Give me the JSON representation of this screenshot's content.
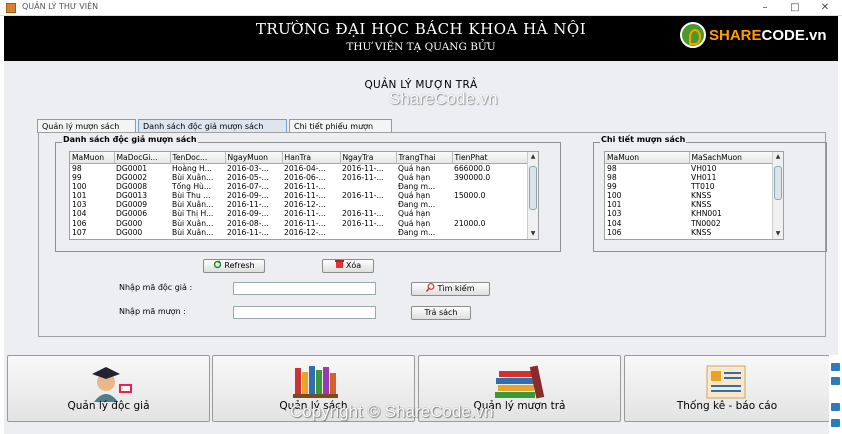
{
  "window": {
    "title": "QUẢN LÝ THƯ VIỆN",
    "controls": [
      "–",
      "□",
      "✕"
    ]
  },
  "header": {
    "title": "TRƯỜNG ĐẠI HỌC BÁCH KHOA HÀ NỘI",
    "subtitle": "THƯ VIỆN TẠ QUANG BỬU"
  },
  "brand": {
    "prefix": "SHARE",
    "suffix": "CODE.vn"
  },
  "main": {
    "title": "QUẢN LÝ MƯỢN TRẢ",
    "watermark": "ShareCode.vn",
    "tabs": [
      "Quản lý mượn sách",
      "Danh sách độc giả mượn sách",
      "Chi tiết phiếu mượn"
    ],
    "active_tab": 1
  },
  "left_group": {
    "title": "Danh sách độc giả mượn sách",
    "columns": [
      "MaMuon",
      "MaDocGi...",
      "TenDoc...",
      "NgayMuon",
      "HanTra",
      "NgayTra",
      "TrangThai",
      "TienPhat"
    ],
    "rows": [
      [
        "98",
        "DG0001",
        "Hoàng H...",
        "2016-03-...",
        "2016-04-...",
        "2016-11-...",
        "Quá hạn",
        "666000.0"
      ],
      [
        "99",
        "DG0002",
        "Bùi Xuân...",
        "2016-05-...",
        "2016-06-...",
        "2016-11-...",
        "Quá hạn",
        "390000.0"
      ],
      [
        "100",
        "DG0008",
        "Tống Hù...",
        "2016-07-...",
        "2016-11-...",
        "",
        "Đang m...",
        ""
      ],
      [
        "101",
        "DG0013",
        "Bùi Thu ...",
        "2016-09-...",
        "2016-11-...",
        "2016-11-...",
        "Quá hạn",
        "15000.0"
      ],
      [
        "103",
        "DG0009",
        "Bùi Xuân...",
        "2016-11-...",
        "2016-12-...",
        "",
        "Đang m...",
        ""
      ],
      [
        "104",
        "DG0006",
        "Bùi Thị H...",
        "2016-09-...",
        "2016-11-...",
        "2016-11-...",
        "Quá hạn",
        ""
      ],
      [
        "106",
        "DG000",
        "Bùi Xuân...",
        "2016-08-...",
        "2016-11-...",
        "2016-11-...",
        "Quá hạn",
        "21000.0"
      ],
      [
        "107",
        "DG000",
        "Bùi Xuân...",
        "2016-11-...",
        "2016-12-...",
        "",
        "Đang m...",
        ""
      ]
    ]
  },
  "right_group": {
    "title": "Chi tiết mượn sách",
    "columns": [
      "MaMuon",
      "MaSachMuon"
    ],
    "rows": [
      [
        "98",
        "VH010"
      ],
      [
        "98",
        "VH011"
      ],
      [
        "99",
        "TT010"
      ],
      [
        "100",
        "KNSS"
      ],
      [
        "101",
        "KNSS"
      ],
      [
        "103",
        "KHN001"
      ],
      [
        "104",
        "TN0002"
      ],
      [
        "106",
        "KNSS"
      ]
    ]
  },
  "actions": {
    "refresh": "Refresh",
    "delete": "Xóa",
    "reader_label": "Nhập mã độc giả :",
    "loan_label": "Nhập mã mượn :",
    "search": "Tìm kiếm",
    "return": "Trả sách"
  },
  "nav": [
    {
      "label": "Quản lý độc giả",
      "icon": "graduate-icon"
    },
    {
      "label": "Quản lý sách",
      "icon": "bookshelf-icon"
    },
    {
      "label": "Quản lý mượn trả",
      "icon": "book-stack-icon"
    },
    {
      "label": "Thống kê - báo cáo",
      "icon": "report-icon"
    }
  ],
  "footer_watermark": "Copyright © ShareCode.vn",
  "colors": {
    "header_bg": "#000000",
    "panel_bg": "#eceef1",
    "brand_green": "#4a9a2b",
    "brand_orange": "#ff9d00"
  }
}
